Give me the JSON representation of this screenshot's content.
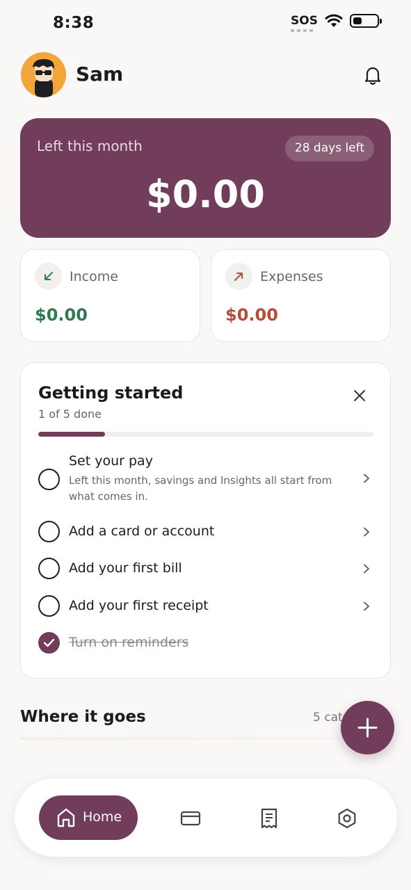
{
  "status_bar": {
    "time": "8:38",
    "sos": "SOS"
  },
  "header": {
    "user_name": "Sam"
  },
  "hero": {
    "label": "Left this month",
    "days_left": "28 days left",
    "amount": "$0.00"
  },
  "stats": {
    "income": {
      "label": "Income",
      "value": "$0.00"
    },
    "expenses": {
      "label": "Expenses",
      "value": "$0.00"
    }
  },
  "getting_started": {
    "title": "Getting started",
    "progress_text": "1 of 5 done",
    "progress_fraction": 0.2,
    "tasks": [
      {
        "title": "Set your pay",
        "description": "Left this month, savings and Insights all start from what comes in.",
        "done": false
      },
      {
        "title": "Add a card or account",
        "done": false
      },
      {
        "title": "Add your first bill",
        "done": false
      },
      {
        "title": "Add your first receipt",
        "done": false
      },
      {
        "title": "Turn on reminders",
        "done": true
      }
    ]
  },
  "where_it_goes": {
    "title": "Where it goes",
    "count_label": "5 cat"
  },
  "nav": {
    "home_label": "Home"
  },
  "colors": {
    "accent": "#723d5a",
    "income_green": "#2f7a52",
    "expense_red": "#b44d3a",
    "background": "#faf8f6"
  },
  "icons": {
    "header": "bell-icon",
    "stats": [
      "arrow-down-left-icon",
      "arrow-up-right-icon"
    ],
    "nav": [
      "home-icon",
      "card-icon",
      "receipt-icon",
      "settings-icon"
    ]
  }
}
